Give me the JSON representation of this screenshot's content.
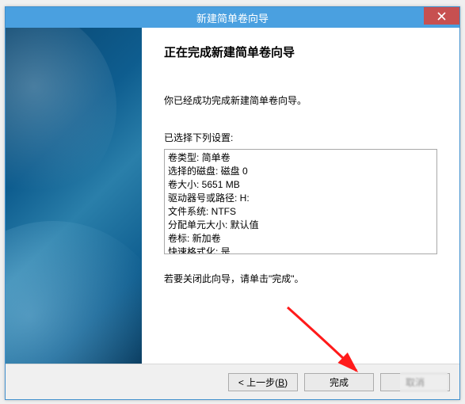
{
  "window": {
    "title": "新建简单卷向导"
  },
  "main": {
    "heading": "正在完成新建简单卷向导",
    "completed_msg": "你已经成功完成新建简单卷向导。",
    "selected_label": "已选择下列设置:",
    "close_hint": "若要关闭此向导，请单击\"完成\"。"
  },
  "settings": {
    "lines": [
      "卷类型: 简单卷",
      "选择的磁盘: 磁盘 0",
      "卷大小: 5651 MB",
      "驱动器号或路径: H:",
      "文件系统: NTFS",
      "分配单元大小: 默认值",
      "卷标: 新加卷",
      "快速格式化: 是"
    ]
  },
  "footer": {
    "back_prefix": "< 上一步(",
    "back_key": "B",
    "back_suffix": ")",
    "finish": "完成",
    "cancel": "取消"
  }
}
